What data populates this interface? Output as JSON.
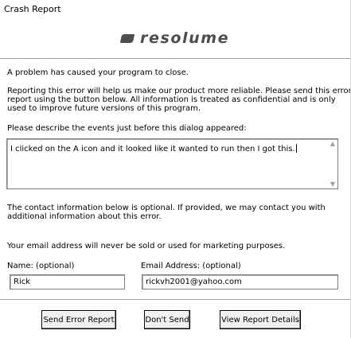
{
  "window": {
    "title": "Crash Report"
  },
  "logo": {
    "wordmark": "resolume"
  },
  "intro": {
    "headline": "A problem has caused your program to close."
  },
  "reporting": {
    "lines": [
      "Reporting this error will help us make our product more reliable.  Please send this error",
      "report using the button below.  All information is treated as confidential and is only",
      "used to improve future versions of this program."
    ]
  },
  "events": {
    "label": "Please describe the events just before this dialog appeared:",
    "value": "I clicked on the A icon and it looked like it wanted to run then I got this."
  },
  "contact": {
    "lines": [
      "The contact information below is optional. If provided, we may contact you with",
      "additional information about this error."
    ],
    "privacy": "Your email address will never be sold or used for marketing purposes.",
    "name_label": "Name: (optional)",
    "name_value": "Rick",
    "email_label": "Email Address: (optional)",
    "email_value": "rickvh2001@yahoo.com"
  },
  "buttons": {
    "send": "Send Error Report",
    "dont_send": "Don't Send",
    "details": "View Report Details"
  }
}
